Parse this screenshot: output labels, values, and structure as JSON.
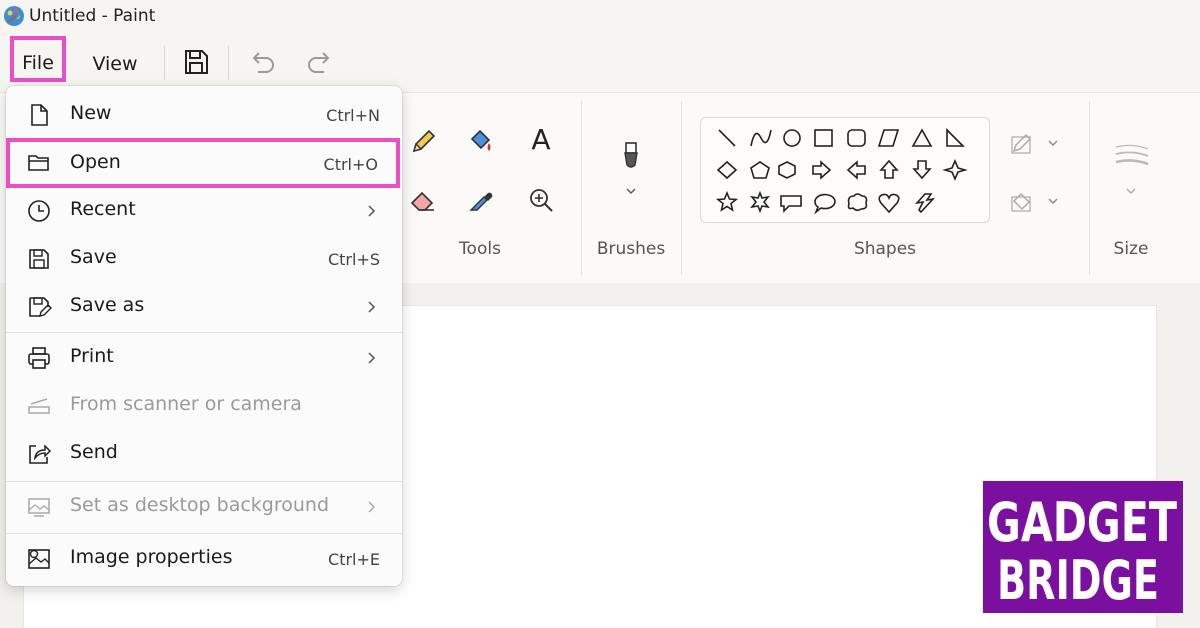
{
  "window": {
    "title": "Untitled - Paint"
  },
  "menubar": {
    "file_label": "File",
    "view_label": "View"
  },
  "toolbar_icons": [
    "save-icon",
    "undo-icon",
    "redo-icon"
  ],
  "ribbon": {
    "tools_label": "Tools",
    "brushes_label": "Brushes",
    "shapes_label": "Shapes",
    "size_label": "Size",
    "text_tool_glyph": "A"
  },
  "file_menu": {
    "items": [
      {
        "label": "New",
        "shortcut": "Ctrl+N",
        "icon": "new-file-icon"
      },
      {
        "label": "Open",
        "shortcut": "Ctrl+O",
        "icon": "folder-icon"
      },
      {
        "label": "Recent",
        "shortcut": "",
        "icon": "clock-icon"
      },
      {
        "label": "Save",
        "shortcut": "Ctrl+S",
        "icon": "save-icon"
      },
      {
        "label": "Save as",
        "shortcut": "",
        "icon": "save-as-icon"
      },
      {
        "label": "Print",
        "shortcut": "",
        "icon": "printer-icon"
      },
      {
        "label": "From scanner or camera",
        "shortcut": "",
        "icon": "scanner-icon"
      },
      {
        "label": "Send",
        "shortcut": "",
        "icon": "share-icon"
      },
      {
        "label": "Set as desktop background",
        "shortcut": "",
        "icon": "desktop-background-icon"
      },
      {
        "label": "Image properties",
        "shortcut": "Ctrl+E",
        "icon": "image-properties-icon"
      }
    ]
  },
  "logo": {
    "line1": "GADGET",
    "line2": "BRIDGE"
  },
  "colors": {
    "highlight": "#ec4fc5",
    "logo_bg": "#7b0fa0"
  }
}
